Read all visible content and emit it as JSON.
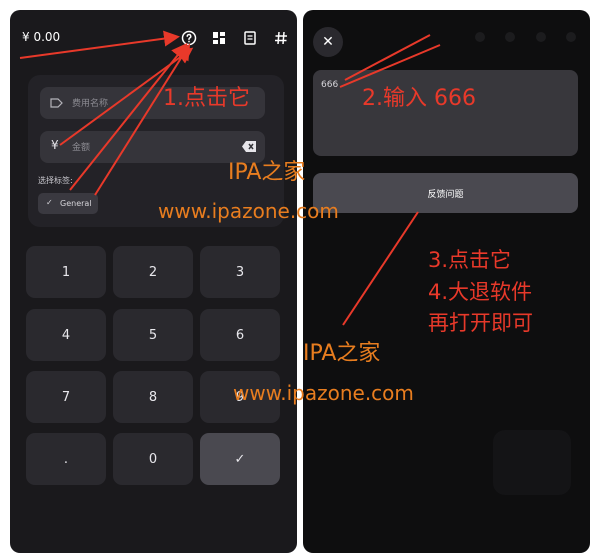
{
  "left_panel": {
    "balance": "¥ 0.00",
    "top_icons": [
      "help-circle-icon",
      "grid-icon",
      "receipt-icon",
      "hash-icon"
    ],
    "expense_name_placeholder": "费用名称",
    "amount_symbol": "¥",
    "amount_placeholder": "金额",
    "tags_label": "选择标签:",
    "tag_chip": "General",
    "keypad": [
      "1",
      "2",
      "3",
      "4",
      "5",
      "6",
      "7",
      "8",
      "9",
      ".",
      "0",
      "✓"
    ]
  },
  "right_panel": {
    "textarea_value": "666",
    "submit_label": "反馈问题"
  },
  "annotations": {
    "step1": "1.点击它",
    "step2": "2.输入 666",
    "step3": "3.点击它",
    "step4": "4.大退软件",
    "step4b": "再打开即可",
    "arrow_color": "#e8392a"
  },
  "watermarks": {
    "name_1": "IPA之家",
    "url_1": "www.ipazone.com",
    "name_2": "IPA之家",
    "url_2": "www.ipazone.com",
    "color": "#e87d1f"
  }
}
